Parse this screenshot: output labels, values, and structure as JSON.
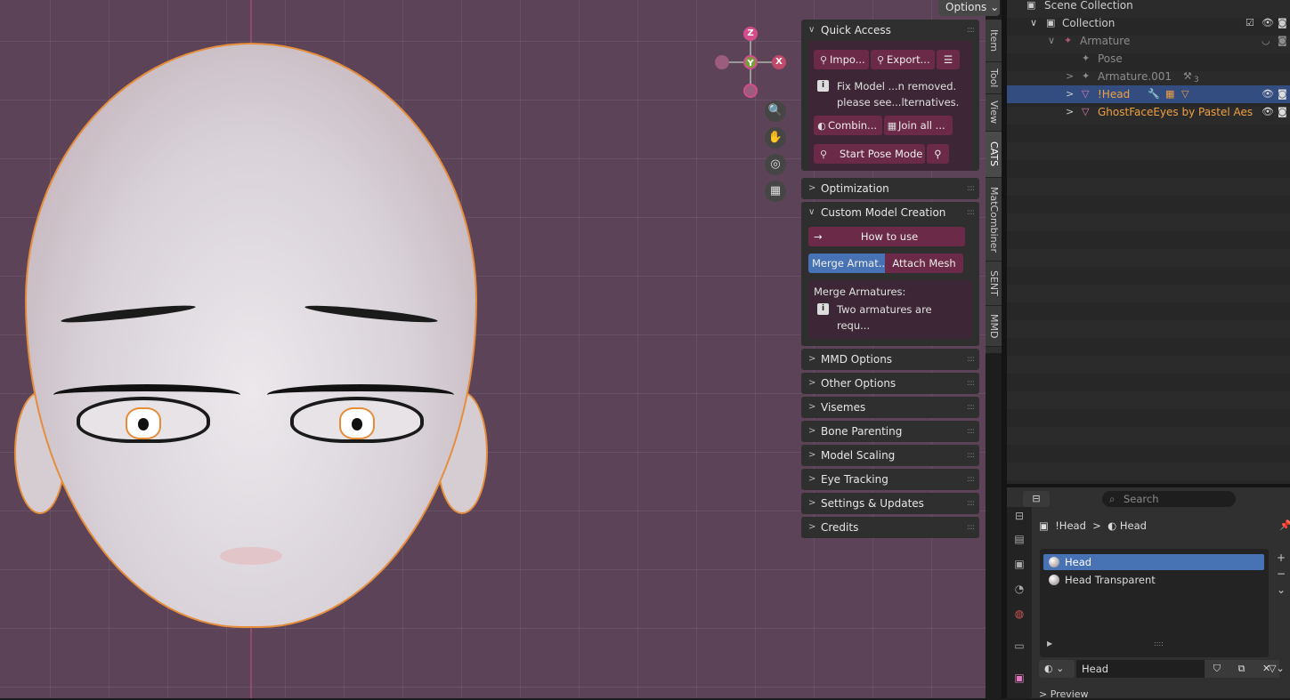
{
  "viewport": {
    "options_label": "Options",
    "gizmo": {
      "z": "Z",
      "y": "Y",
      "x": "X"
    }
  },
  "npanel": {
    "quick_access": {
      "title": "Quick Access",
      "import_label": "Impo...",
      "export_label": "Export...",
      "fix_line1": "Fix Model ...n removed.",
      "fix_line2": "please see...lternatives.",
      "combine_label": "Combin...",
      "join_label": "Join all ...",
      "pose_label": "Start Pose Mode"
    },
    "optimization": "Optimization",
    "custom": {
      "title": "Custom Model Creation",
      "howto": "How to use",
      "merge_tab": "Merge Armat...",
      "attach_tab": "Attach Mesh",
      "merge_title": "Merge Armatures:",
      "merge_info": "Two armatures are requ..."
    },
    "collapsed": [
      "MMD Options",
      "Other Options",
      "Visemes",
      "Bone Parenting",
      "Model Scaling",
      "Eye Tracking",
      "Settings & Updates",
      "Credits"
    ]
  },
  "sidebar_tabs": [
    "Item",
    "Tool",
    "View",
    "CATS",
    "MatCombiner",
    "SENT",
    "MMD"
  ],
  "outliner": {
    "scene_collection": "Scene Collection",
    "collection": "Collection",
    "armature": "Armature",
    "pose": "Pose",
    "armature001": "Armature.001",
    "armature001_count": "3",
    "head": "!Head",
    "eyes": "GhostFaceEyes by Pastel Aes"
  },
  "properties": {
    "search_placeholder": "Search",
    "breadcrumb_object": "!Head",
    "breadcrumb_material": "Head",
    "materials": [
      "Head",
      "Head Transparent"
    ],
    "material_field": "Head",
    "preview_label": "Preview"
  },
  "colors": {
    "accent_orange": "#e58d3a",
    "selection_blue": "#334d80",
    "cats_button": "#6b2a48",
    "viewport_bg": "#5d4358"
  }
}
